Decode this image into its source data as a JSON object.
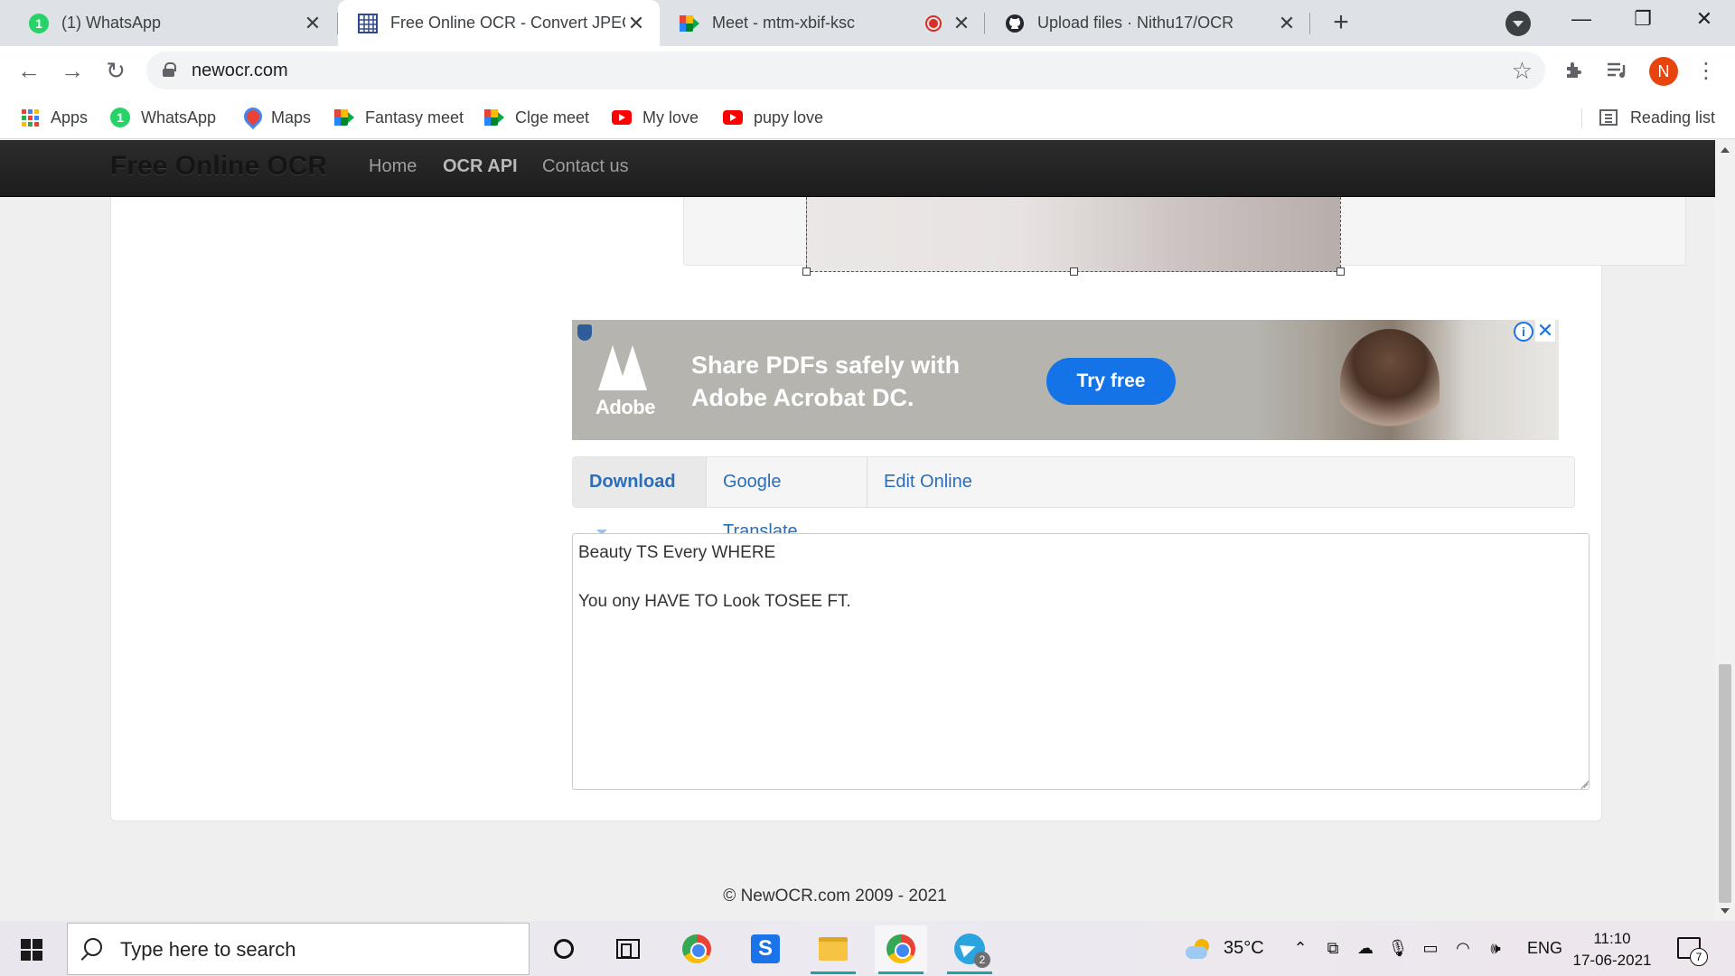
{
  "browser": {
    "tabs": [
      {
        "title": "(1) WhatsApp",
        "badge": "1"
      },
      {
        "title": "Free Online OCR - Convert JPEG, ",
        "active": true
      },
      {
        "title": "Meet - mtm-xbif-ksc",
        "recording": true
      },
      {
        "title": "Upload files · Nithu17/OCR"
      }
    ],
    "url": "newocr.com",
    "profile_initial": "N",
    "bookmarks": [
      {
        "label": "Apps",
        "icon": "apps-grid-icon"
      },
      {
        "label": "WhatsApp",
        "icon": "whatsapp-icon",
        "badge": "1"
      },
      {
        "label": "Maps",
        "icon": "maps-pin-icon"
      },
      {
        "label": "Fantasy meet",
        "icon": "google-meet-icon"
      },
      {
        "label": "Clge meet",
        "icon": "google-meet-icon"
      },
      {
        "label": "My love",
        "icon": "youtube-icon"
      },
      {
        "label": "pupy love",
        "icon": "youtube-icon"
      }
    ],
    "reading_list": "Reading list"
  },
  "site": {
    "brand": "Free Online OCR",
    "nav": [
      "Home",
      "OCR API",
      "Contact us"
    ],
    "ad": {
      "brand_word": "Adobe",
      "headline": "Share PDFs safely with Adobe Acrobat DC.",
      "cta": "Try free"
    },
    "actions": {
      "download": "Download",
      "translate": "Google Translate",
      "edit": "Edit Online"
    },
    "ocr_result": "Beauty TS Every WHERE\n\nYou ony HAVE TO Look TOSEE FT.",
    "footer": "© NewOCR.com 2009 - 2021"
  },
  "taskbar": {
    "search_placeholder": "Type here to search",
    "temperature": "35°C",
    "language": "ENG",
    "time": "11:10",
    "date": "17-06-2021",
    "notification_count": "7",
    "telegram_badge": "2"
  },
  "colors": {
    "accent_link": "#2a6ebb",
    "navbar": "#222222",
    "adobe_cta": "#1473e6",
    "chrome_profile": "#e8440d"
  }
}
